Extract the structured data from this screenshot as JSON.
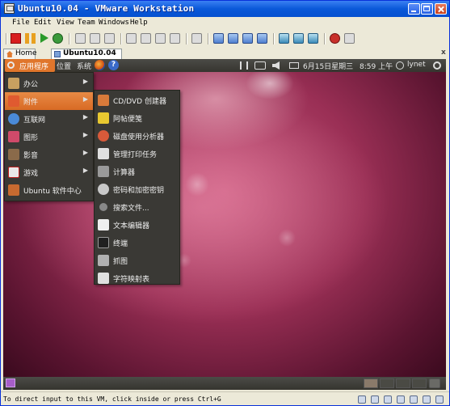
{
  "window": {
    "title": "Ubuntu10.04 - VMware Workstation"
  },
  "menubar": [
    "File",
    "Edit",
    "View",
    "Team",
    "Windows",
    "Help"
  ],
  "tabs": [
    {
      "label": "Home",
      "icon": "home-icon"
    },
    {
      "label": "Ubuntu10.04",
      "icon": "vm-icon",
      "active": true,
      "close": "x"
    }
  ],
  "ubuntu_panel": {
    "menus": [
      "应用程序",
      "位置",
      "系统"
    ],
    "datetime": "6月15日星期三",
    "time": "8:59 上午",
    "user": "lynet",
    "help_glyph": "?"
  },
  "apps_menu": [
    {
      "label": "办公",
      "icon": "office-icon",
      "color": "#c8a060",
      "submenu": true
    },
    {
      "label": "附件",
      "icon": "accessories-icon",
      "color": "#e05a30",
      "submenu": true,
      "selected": true
    },
    {
      "label": "互联网",
      "icon": "internet-icon",
      "color": "#4a8ad8",
      "submenu": true
    },
    {
      "label": "图形",
      "icon": "graphics-icon",
      "color": "#d04a6a",
      "submenu": true
    },
    {
      "label": "影音",
      "icon": "media-icon",
      "color": "#8a6a4a",
      "submenu": true
    },
    {
      "label": "游戏",
      "icon": "games-icon",
      "color": "#e8e8e8",
      "submenu": true
    },
    {
      "label": "Ubuntu 软件中心",
      "icon": "software-center-icon",
      "color": "#c86a30",
      "submenu": false
    }
  ],
  "accessories_menu": [
    {
      "label": "CD/DVD 创建器",
      "icon": "cd-dvd-creator-icon",
      "color": "#d87a3a"
    },
    {
      "label": "阿帖便笺",
      "icon": "sticky-notes-icon",
      "color": "#e8c830"
    },
    {
      "label": "磁盘使用分析器",
      "icon": "disk-analyzer-icon",
      "color": "#d85a3a"
    },
    {
      "label": "管理打印任务",
      "icon": "printer-icon",
      "color": "#e0e0e0"
    },
    {
      "label": "计算器",
      "icon": "calculator-icon",
      "color": "#9a9a9a"
    },
    {
      "label": "密码和加密密钥",
      "icon": "keys-icon",
      "color": "#c8c8c8"
    },
    {
      "label": "搜索文件...",
      "icon": "search-icon",
      "color": "#888888"
    },
    {
      "label": "文本编辑器",
      "icon": "text-editor-icon",
      "color": "#f0f0f0"
    },
    {
      "label": "终端",
      "icon": "terminal-icon",
      "color": "#202020"
    },
    {
      "label": "抓图",
      "icon": "screenshot-icon",
      "color": "#b0b0b0"
    },
    {
      "label": "字符映射表",
      "icon": "character-map-icon",
      "color": "#e0e0e0"
    }
  ],
  "statusbar": {
    "text": "To direct input to this VM, click inside or press Ctrl+G"
  },
  "colors": {
    "accent_orange": "#e0762c",
    "xp_blue": "#0a58d8",
    "panel_dark": "#3a3935"
  }
}
